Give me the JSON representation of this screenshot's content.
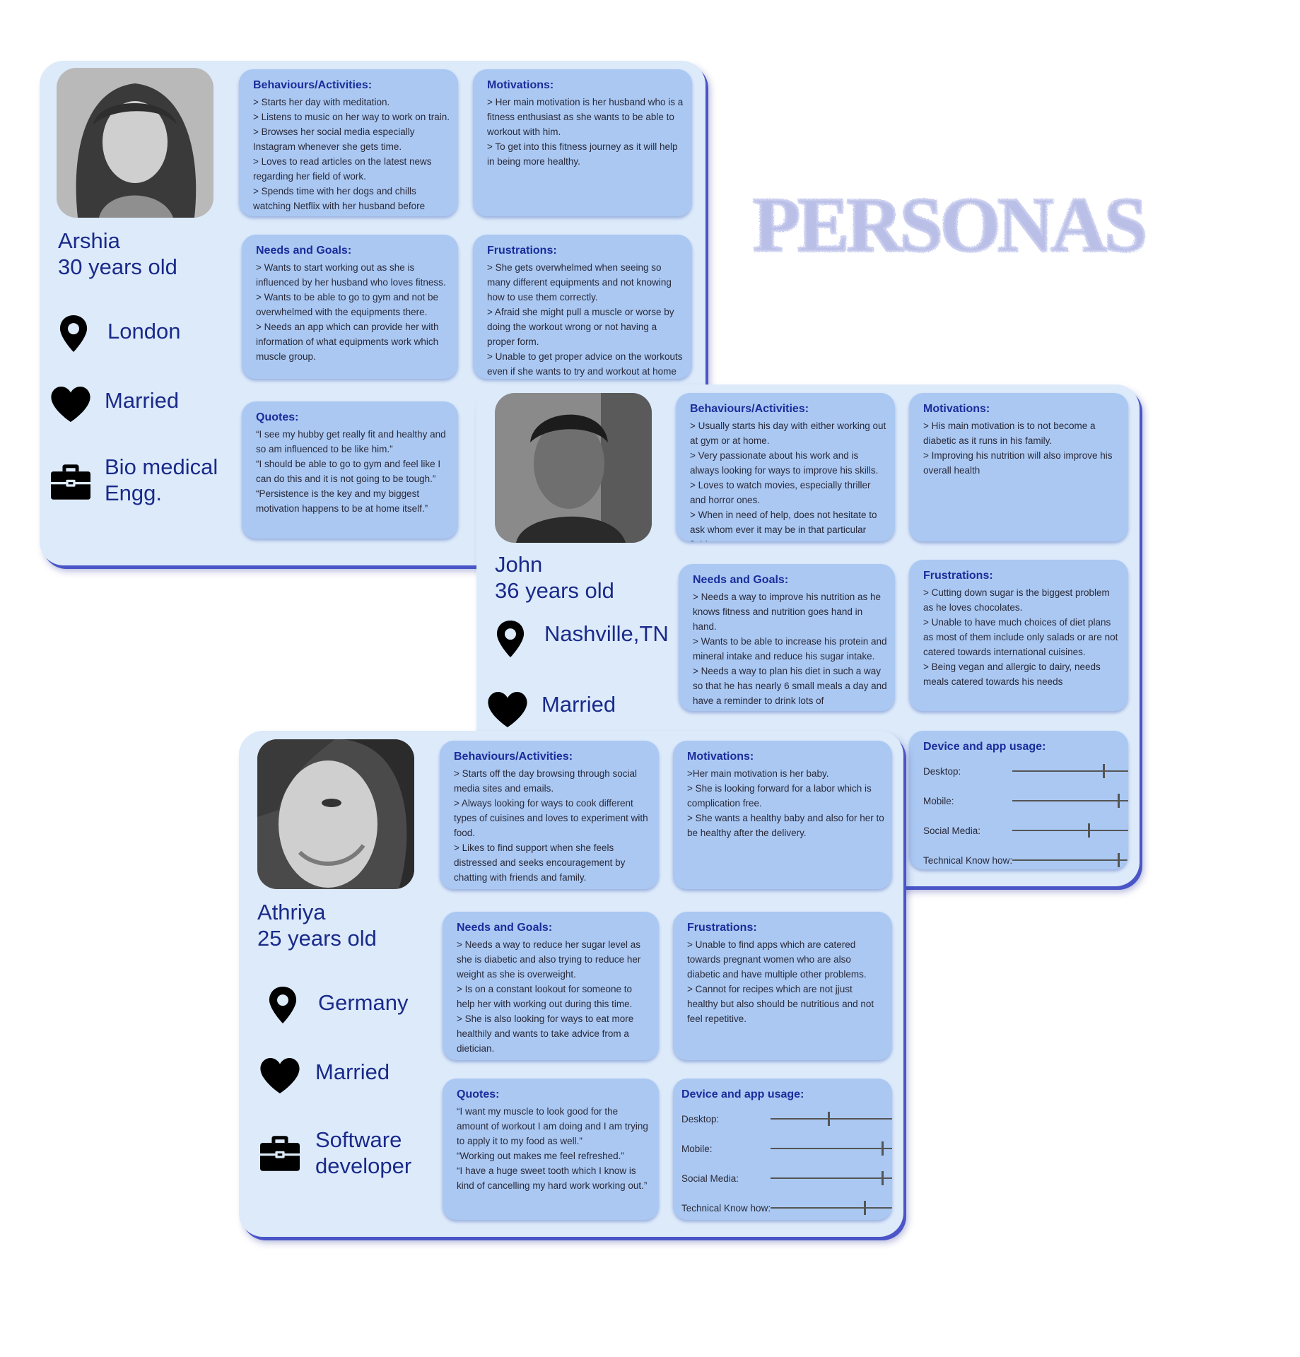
{
  "page_title": "PERSONAS",
  "colors": {
    "card_bg": "#dceafa",
    "box_bg": "#aac8f2",
    "heading": "#1a2d9b",
    "name_text": "#1a2a8a",
    "title": "#b9bfe6"
  },
  "personas": [
    {
      "name": "Arshia",
      "age": "30 years old",
      "location": "London",
      "status": "Married",
      "occupation": "Bio medical\nEngg.",
      "behaviours": {
        "title": "Behaviours/Activities:",
        "text": "> Starts her day with meditation.\n> Listens to music on her way to work on train.\n> Browses her social media especially Instagram whenever she gets time.\n> Loves to read articles on the latest news regarding her field of work.\n> Spends time with her dogs and chills watching Netflix with her husband before turning in."
      },
      "motivations": {
        "title": "Motivations:",
        "text": "> Her main motivation is her husband who is a fitness enthusiast as she wants to be able to workout with him.\n> To get into this fitness journey as it will help in being more healthy."
      },
      "needs": {
        "title": "Needs and Goals:",
        "text": "> Wants to start working out as she is influenced by her husband who loves fitness.\n> Wants to be able to go to gym and not be overwhelmed with the equipments there.\n> Needs an app which can provide her with information of what equipments work which muscle group."
      },
      "frustrations": {
        "title": "Frustrations:",
        "text": "> She gets overwhelmed when seeing so many different equipments and not knowing how to use them correctly.\n> Afraid she might pull a muscle or worse by doing the workout wrong or not having a proper form.\n> Unable to get proper advice on the workouts even if she wants to try and workout at home with her husband."
      },
      "quotes": {
        "title": "Quotes:",
        "text": "“I see my hubby get really fit and healthy and so am influenced to be like him.”\n“I should be able to go to gym and feel like I can do this and it is not going to be tough.”\n“Persistence is the key and my biggest motivation happens to be at home itself.”"
      }
    },
    {
      "name": "John",
      "age": "36 years old",
      "location": "Nashville,TN",
      "status": "Married",
      "behaviours": {
        "title": "Behaviours/Activities:",
        "text": "> Usually starts his day with either working out at gym or at home.\n> Very passionate about his work and is always looking for ways to improve his skills.\n> Loves to watch movies, especially thriller and horror ones.\n> When in need of help, does not hesitate to ask whom ever it may be in that particular field."
      },
      "motivations": {
        "title": "Motivations:",
        "text": "> His main motivation is to not become a diabetic as it runs in his family.\n> Improving his nutrition will also improve his overall health"
      },
      "needs": {
        "title": "Needs and Goals:",
        "text": "> Needs a way to improve his nutrition as he knows fitness and nutrition goes hand in hand.\n> Wants to be able to increase his protein and mineral intake and reduce his sugar intake.\n> Needs a way to plan his diet in such a way so that he has nearly 6 small meals a day and have a reminder to drink lots of"
      },
      "frustrations": {
        "title": "Frustrations:",
        "text": "> Cutting down sugar is the biggest problem as he loves chocolates.\n> Unable to have much choices of diet plans as most of them include only salads or are not catered towards international cuisines.\n> Being vegan and allergic to dairy, needs meals catered towards his needs"
      },
      "usage": {
        "title": "Device and app usage:",
        "items": [
          {
            "label": "Desktop:",
            "level": 0.78
          },
          {
            "label": "Mobile:",
            "level": 0.91
          },
          {
            "label": "Social Media:",
            "level": 0.65
          },
          {
            "label": "Technical Know how:",
            "level": 0.91
          }
        ]
      }
    },
    {
      "name": "Athriya",
      "age": "25 years old",
      "location": "Germany",
      "status": "Married",
      "occupation": "Software\ndeveloper",
      "behaviours": {
        "title": "Behaviours/Activities:",
        "text": "> Starts off the day browsing through social media sites and emails.\n> Always looking for ways to cook different types of cuisines and loves to experiment with food.\n> Likes to find support when she feels distressed and seeks encouragement by chatting with friends and family."
      },
      "motivations": {
        "title": "Motivations:",
        "text": ">Her main motivation is her baby.\n> She is looking forward for a labor which is complication free.\n> She wants a healthy baby and also for her to be healthy after the delivery."
      },
      "needs": {
        "title": "Needs and Goals:",
        "text": "> Needs a way to reduce her sugar level as she is diabetic and also trying to reduce her weight as she is overweight.\n> Is on a constant lookout for someone to help her with working out during this time.\n> She is also looking for ways to eat more healthily and wants to take advice from a dietician."
      },
      "frustrations": {
        "title": "Frustrations:",
        "text": "> Unable to find apps which are catered towards pregnant women who are also diabetic and have multiple other problems.\n> Cannot for recipes which are not jjust healthy but also should be nutritious and not feel repetitive."
      },
      "quotes": {
        "title": "Quotes:",
        "text": "“I want my muscle to look good for the amount of workout I am doing and I am trying to apply it to my food as well.”\n“Working out makes me feel refreshed.”\n“I have a huge sweet tooth which I know is kind of cancelling my hard work working out.”"
      },
      "usage": {
        "title": "Device and app usage:",
        "items": [
          {
            "label": "Desktop:",
            "level": 0.47
          },
          {
            "label": "Mobile:",
            "level": 0.91
          },
          {
            "label": "Social Media:",
            "level": 0.91
          },
          {
            "label": "Technical Know how:",
            "level": 0.77
          }
        ]
      }
    }
  ]
}
